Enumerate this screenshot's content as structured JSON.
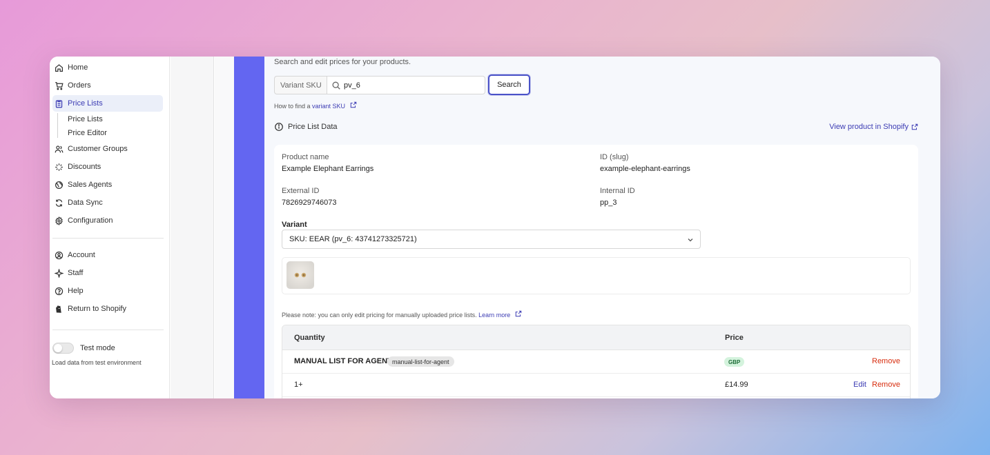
{
  "sidebar": {
    "items": [
      {
        "label": "Home",
        "icon": "home-icon"
      },
      {
        "label": "Orders",
        "icon": "cart-icon"
      },
      {
        "label": "Price Lists",
        "icon": "clipboard-icon"
      },
      {
        "label": "Customer Groups",
        "icon": "users-icon"
      },
      {
        "label": "Discounts",
        "icon": "discount-icon"
      },
      {
        "label": "Sales Agents",
        "icon": "globe-icon"
      },
      {
        "label": "Data Sync",
        "icon": "sync-icon"
      },
      {
        "label": "Configuration",
        "icon": "gear-icon"
      }
    ],
    "sub_items": [
      "Price Lists",
      "Price Editor"
    ],
    "bottom_items": [
      {
        "label": "Account",
        "icon": "account-icon"
      },
      {
        "label": "Staff",
        "icon": "staff-icon"
      },
      {
        "label": "Help",
        "icon": "help-icon"
      },
      {
        "label": "Return to Shopify",
        "icon": "shopify-icon"
      }
    ],
    "test_mode": {
      "label": "Test mode",
      "help": "Load data from test environment",
      "enabled": false
    }
  },
  "main": {
    "subtitle": "Search and edit prices for your products.",
    "search": {
      "prefix": "Variant SKU",
      "value": "pv_6",
      "button": "Search",
      "help_prefix": "How to find a ",
      "help_link": "variant SKU"
    },
    "section_title": "Price List Data",
    "view_link": "View product in Shopify",
    "product": {
      "name_label": "Product name",
      "name": "Example Elephant Earrings",
      "slug_label": "ID (slug)",
      "slug": "example-elephant-earrings",
      "external_label": "External ID",
      "external_id": "7826929746073",
      "internal_label": "Internal ID",
      "internal_id": "pp_3",
      "variant_label": "Variant",
      "variant_value": "SKU: EEAR (pv_6: 43741273325721)"
    },
    "note": "Please note: you can only edit pricing for manually uploaded price lists. ",
    "note_link": "Learn more",
    "table": {
      "headers": [
        "Quantity",
        "Price"
      ],
      "group": {
        "name": "MANUAL LIST FOR AGENT",
        "tag": "manual-list-for-agent",
        "currency": "GBP",
        "action": "Remove"
      },
      "rows": [
        {
          "quantity": "1+",
          "price": "£14.99",
          "edit": "Edit",
          "remove": "Remove"
        }
      ]
    }
  },
  "colors": {
    "accent": "#6366f1",
    "link": "#3b3bb3",
    "danger": "#d72c0d",
    "success_bg": "#d4f3dd"
  }
}
